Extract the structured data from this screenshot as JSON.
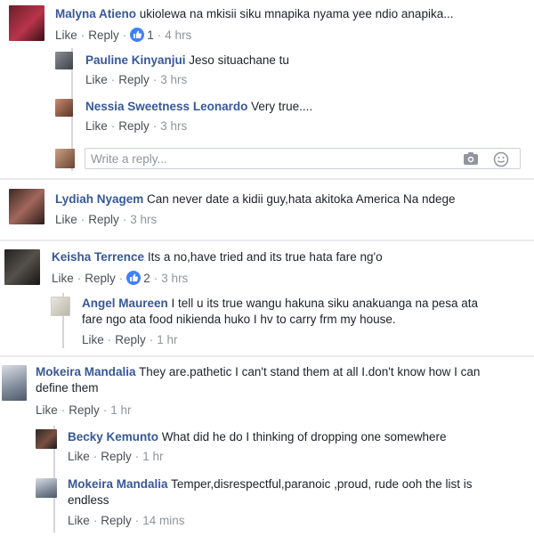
{
  "actions": {
    "like": "Like",
    "reply": "Reply"
  },
  "comments": [
    {
      "name": "Malyna Atieno",
      "text": "ukiolewa na mkisii siku mnapika nyama yee ndio anapika...",
      "reactions": "1",
      "time": "4 hrs"
    },
    {
      "name": "Pauline Kinyanjui",
      "text": "Jeso situachane tu",
      "time": "3 hrs"
    },
    {
      "name": "Nessia Sweetness Leonardo",
      "text": "Very true....",
      "time": "3 hrs"
    },
    {
      "name": "Lydiah Nyagem",
      "text": "Can never date a kidii guy,hata akitoka America Na ndege",
      "time": "3 hrs"
    },
    {
      "name": "Keisha Terrence",
      "text": "Its a no,have tried and its true hata fare ng'o",
      "reactions": "2",
      "time": "3 hrs"
    },
    {
      "name": "Angel Maureen",
      "text": "I tell u its true wangu hakuna siku anakuanga na pesa ata fare ngo ata food nikienda huko I hv to carry frm my house.",
      "time": "1 hr"
    },
    {
      "name": "Mokeira Mandalia",
      "text": "They are.pathetic I can't stand them at all I.don't know how I can define them",
      "time": "1 hr"
    },
    {
      "name": "Becky Kemunto",
      "text": "What did he do I thinking of dropping one somewhere",
      "time": "1 hr"
    },
    {
      "name": "Mokeira Mandalia",
      "text": "Temper,disrespectful,paranoic ,proud, rude ooh the list is endless",
      "time": "14 mins"
    }
  ],
  "reply_box": {
    "placeholder": "Write a reply..."
  },
  "colors": {
    "name": "#365899",
    "meta": "#90949c",
    "like_badge": "#4080ff",
    "separator": "#e9ebee"
  },
  "icons": {
    "reaction": "like-badge-icon",
    "camera": "camera-icon",
    "emoji": "emoji-icon"
  }
}
